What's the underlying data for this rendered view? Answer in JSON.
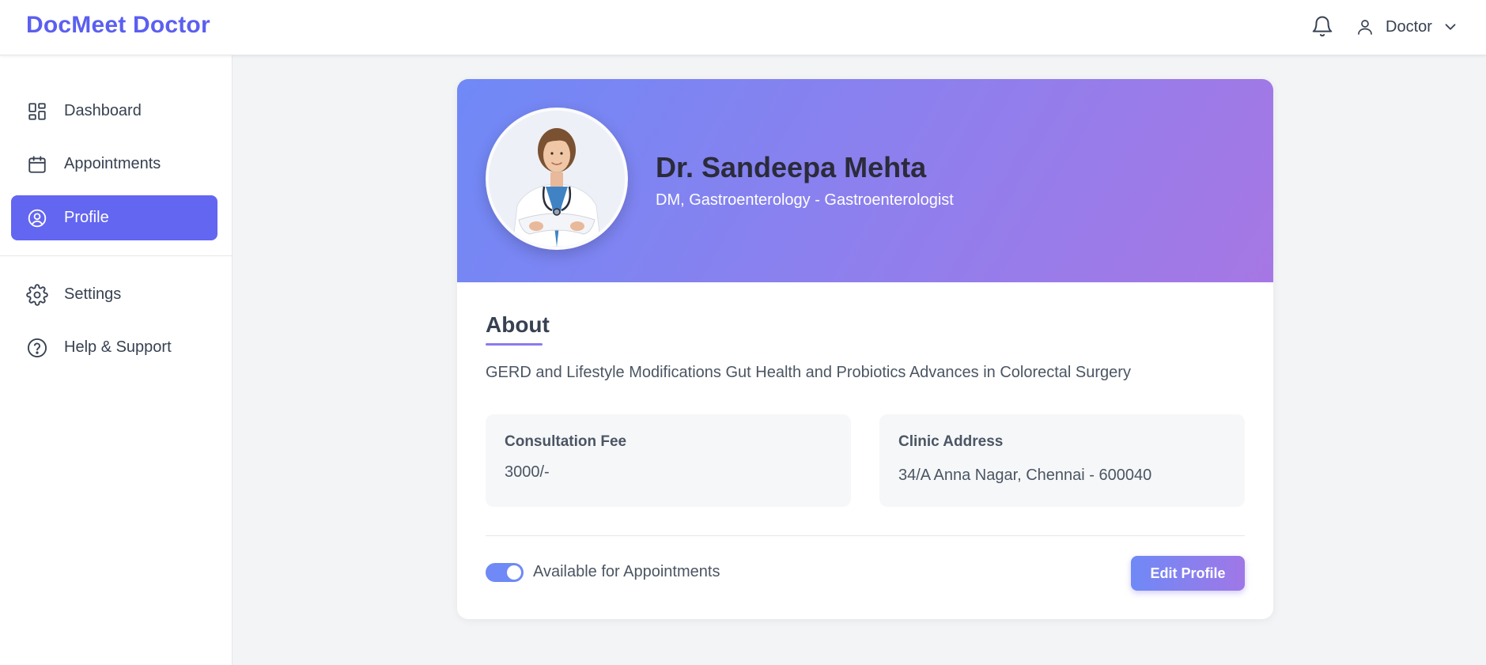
{
  "app": {
    "brand": "DocMeet Doctor"
  },
  "header": {
    "user_label": "Doctor",
    "bell_icon": "bell-icon",
    "user_icon": "user-icon",
    "chevron_icon": "chevron-down-icon"
  },
  "sidebar": {
    "items": [
      {
        "label": "Dashboard",
        "icon": "grid-icon",
        "active": false
      },
      {
        "label": "Appointments",
        "icon": "calendar-icon",
        "active": false
      },
      {
        "label": "Profile",
        "icon": "user-circle-icon",
        "active": true
      },
      {
        "label": "Settings",
        "icon": "gear-icon",
        "active": false
      },
      {
        "label": "Help & Support",
        "icon": "help-circle-icon",
        "active": false
      }
    ]
  },
  "profile": {
    "name": "Dr. Sandeepa Mehta",
    "specialization": "DM, Gastroenterology - Gastroenterologist",
    "about_title": "About",
    "about_text": "GERD and Lifestyle Modifications Gut Health and Probiotics Advances in Colorectal Surgery",
    "fee_label": "Consultation Fee",
    "fee_value": "3000/-",
    "address_label": "Clinic Address",
    "address_value": "34/A Anna Nagar, Chennai - 600040",
    "availability_label": "Available for Appointments",
    "available": true,
    "edit_button": "Edit Profile"
  },
  "colors": {
    "brand": "#5b5ff0",
    "active_nav": "#6366f1",
    "banner_start": "#6f89f6",
    "banner_end": "#a677e4"
  }
}
